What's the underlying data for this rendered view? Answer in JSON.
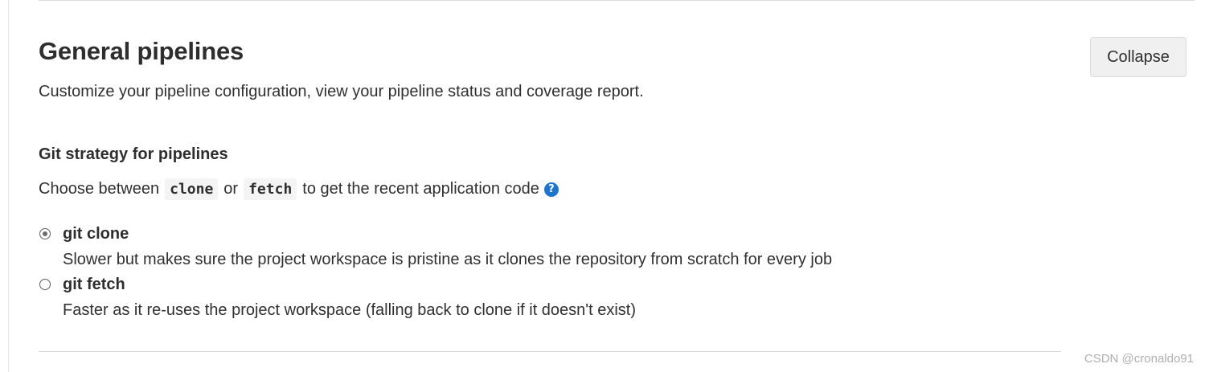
{
  "section": {
    "title": "General pipelines",
    "description": "Customize your pipeline configuration, view your pipeline status and coverage report.",
    "collapse_label": "Collapse"
  },
  "git_strategy": {
    "title": "Git strategy for pipelines",
    "help_prefix": "Choose between",
    "code_clone": "clone",
    "help_or": "or",
    "code_fetch": "fetch",
    "help_suffix": "to get the recent application code",
    "help_icon": "question-circle-icon",
    "help_icon_glyph": "?",
    "selected": "git clone",
    "options": [
      {
        "label": "git clone",
        "help": "Slower but makes sure the project workspace is pristine as it clones the repository from scratch for every job",
        "checked": true
      },
      {
        "label": "git fetch",
        "help": "Faster as it re-uses the project workspace (falling back to clone if it doesn't exist)",
        "checked": false
      }
    ]
  },
  "watermark": "CSDN @cronaldo91",
  "colors": {
    "accent": "#1f75cb",
    "text": "#2e2e2e",
    "button_bg": "#f0f0f0",
    "border": "#dbdbdb"
  }
}
